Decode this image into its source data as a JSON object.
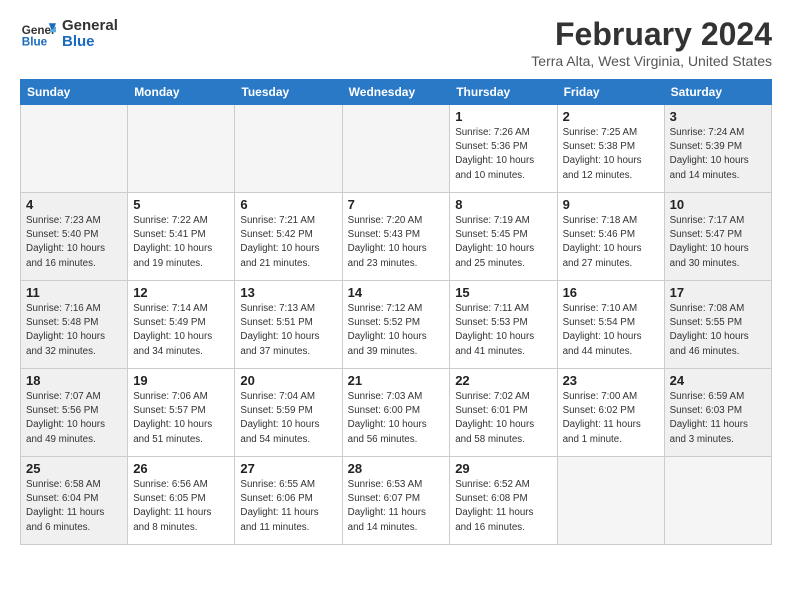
{
  "header": {
    "logo_line1": "General",
    "logo_line2": "Blue",
    "month_year": "February 2024",
    "location": "Terra Alta, West Virginia, United States"
  },
  "weekdays": [
    "Sunday",
    "Monday",
    "Tuesday",
    "Wednesday",
    "Thursday",
    "Friday",
    "Saturday"
  ],
  "weeks": [
    [
      {
        "day": "",
        "info": "",
        "type": "empty"
      },
      {
        "day": "",
        "info": "",
        "type": "empty"
      },
      {
        "day": "",
        "info": "",
        "type": "empty"
      },
      {
        "day": "",
        "info": "",
        "type": "empty"
      },
      {
        "day": "1",
        "info": "Sunrise: 7:26 AM\nSunset: 5:36 PM\nDaylight: 10 hours\nand 10 minutes.",
        "type": "weekday"
      },
      {
        "day": "2",
        "info": "Sunrise: 7:25 AM\nSunset: 5:38 PM\nDaylight: 10 hours\nand 12 minutes.",
        "type": "weekday"
      },
      {
        "day": "3",
        "info": "Sunrise: 7:24 AM\nSunset: 5:39 PM\nDaylight: 10 hours\nand 14 minutes.",
        "type": "weekend-sat"
      }
    ],
    [
      {
        "day": "4",
        "info": "Sunrise: 7:23 AM\nSunset: 5:40 PM\nDaylight: 10 hours\nand 16 minutes.",
        "type": "weekend-sun"
      },
      {
        "day": "5",
        "info": "Sunrise: 7:22 AM\nSunset: 5:41 PM\nDaylight: 10 hours\nand 19 minutes.",
        "type": "weekday"
      },
      {
        "day": "6",
        "info": "Sunrise: 7:21 AM\nSunset: 5:42 PM\nDaylight: 10 hours\nand 21 minutes.",
        "type": "weekday"
      },
      {
        "day": "7",
        "info": "Sunrise: 7:20 AM\nSunset: 5:43 PM\nDaylight: 10 hours\nand 23 minutes.",
        "type": "weekday"
      },
      {
        "day": "8",
        "info": "Sunrise: 7:19 AM\nSunset: 5:45 PM\nDaylight: 10 hours\nand 25 minutes.",
        "type": "weekday"
      },
      {
        "day": "9",
        "info": "Sunrise: 7:18 AM\nSunset: 5:46 PM\nDaylight: 10 hours\nand 27 minutes.",
        "type": "weekday"
      },
      {
        "day": "10",
        "info": "Sunrise: 7:17 AM\nSunset: 5:47 PM\nDaylight: 10 hours\nand 30 minutes.",
        "type": "weekend-sat"
      }
    ],
    [
      {
        "day": "11",
        "info": "Sunrise: 7:16 AM\nSunset: 5:48 PM\nDaylight: 10 hours\nand 32 minutes.",
        "type": "weekend-sun"
      },
      {
        "day": "12",
        "info": "Sunrise: 7:14 AM\nSunset: 5:49 PM\nDaylight: 10 hours\nand 34 minutes.",
        "type": "weekday"
      },
      {
        "day": "13",
        "info": "Sunrise: 7:13 AM\nSunset: 5:51 PM\nDaylight: 10 hours\nand 37 minutes.",
        "type": "weekday"
      },
      {
        "day": "14",
        "info": "Sunrise: 7:12 AM\nSunset: 5:52 PM\nDaylight: 10 hours\nand 39 minutes.",
        "type": "weekday"
      },
      {
        "day": "15",
        "info": "Sunrise: 7:11 AM\nSunset: 5:53 PM\nDaylight: 10 hours\nand 41 minutes.",
        "type": "weekday"
      },
      {
        "day": "16",
        "info": "Sunrise: 7:10 AM\nSunset: 5:54 PM\nDaylight: 10 hours\nand 44 minutes.",
        "type": "weekday"
      },
      {
        "day": "17",
        "info": "Sunrise: 7:08 AM\nSunset: 5:55 PM\nDaylight: 10 hours\nand 46 minutes.",
        "type": "weekend-sat"
      }
    ],
    [
      {
        "day": "18",
        "info": "Sunrise: 7:07 AM\nSunset: 5:56 PM\nDaylight: 10 hours\nand 49 minutes.",
        "type": "weekend-sun"
      },
      {
        "day": "19",
        "info": "Sunrise: 7:06 AM\nSunset: 5:57 PM\nDaylight: 10 hours\nand 51 minutes.",
        "type": "weekday"
      },
      {
        "day": "20",
        "info": "Sunrise: 7:04 AM\nSunset: 5:59 PM\nDaylight: 10 hours\nand 54 minutes.",
        "type": "weekday"
      },
      {
        "day": "21",
        "info": "Sunrise: 7:03 AM\nSunset: 6:00 PM\nDaylight: 10 hours\nand 56 minutes.",
        "type": "weekday"
      },
      {
        "day": "22",
        "info": "Sunrise: 7:02 AM\nSunset: 6:01 PM\nDaylight: 10 hours\nand 58 minutes.",
        "type": "weekday"
      },
      {
        "day": "23",
        "info": "Sunrise: 7:00 AM\nSunset: 6:02 PM\nDaylight: 11 hours\nand 1 minute.",
        "type": "weekday"
      },
      {
        "day": "24",
        "info": "Sunrise: 6:59 AM\nSunset: 6:03 PM\nDaylight: 11 hours\nand 3 minutes.",
        "type": "weekend-sat"
      }
    ],
    [
      {
        "day": "25",
        "info": "Sunrise: 6:58 AM\nSunset: 6:04 PM\nDaylight: 11 hours\nand 6 minutes.",
        "type": "weekend-sun"
      },
      {
        "day": "26",
        "info": "Sunrise: 6:56 AM\nSunset: 6:05 PM\nDaylight: 11 hours\nand 8 minutes.",
        "type": "weekday"
      },
      {
        "day": "27",
        "info": "Sunrise: 6:55 AM\nSunset: 6:06 PM\nDaylight: 11 hours\nand 11 minutes.",
        "type": "weekday"
      },
      {
        "day": "28",
        "info": "Sunrise: 6:53 AM\nSunset: 6:07 PM\nDaylight: 11 hours\nand 14 minutes.",
        "type": "weekday"
      },
      {
        "day": "29",
        "info": "Sunrise: 6:52 AM\nSunset: 6:08 PM\nDaylight: 11 hours\nand 16 minutes.",
        "type": "weekday"
      },
      {
        "day": "",
        "info": "",
        "type": "empty"
      },
      {
        "day": "",
        "info": "",
        "type": "empty"
      }
    ]
  ]
}
